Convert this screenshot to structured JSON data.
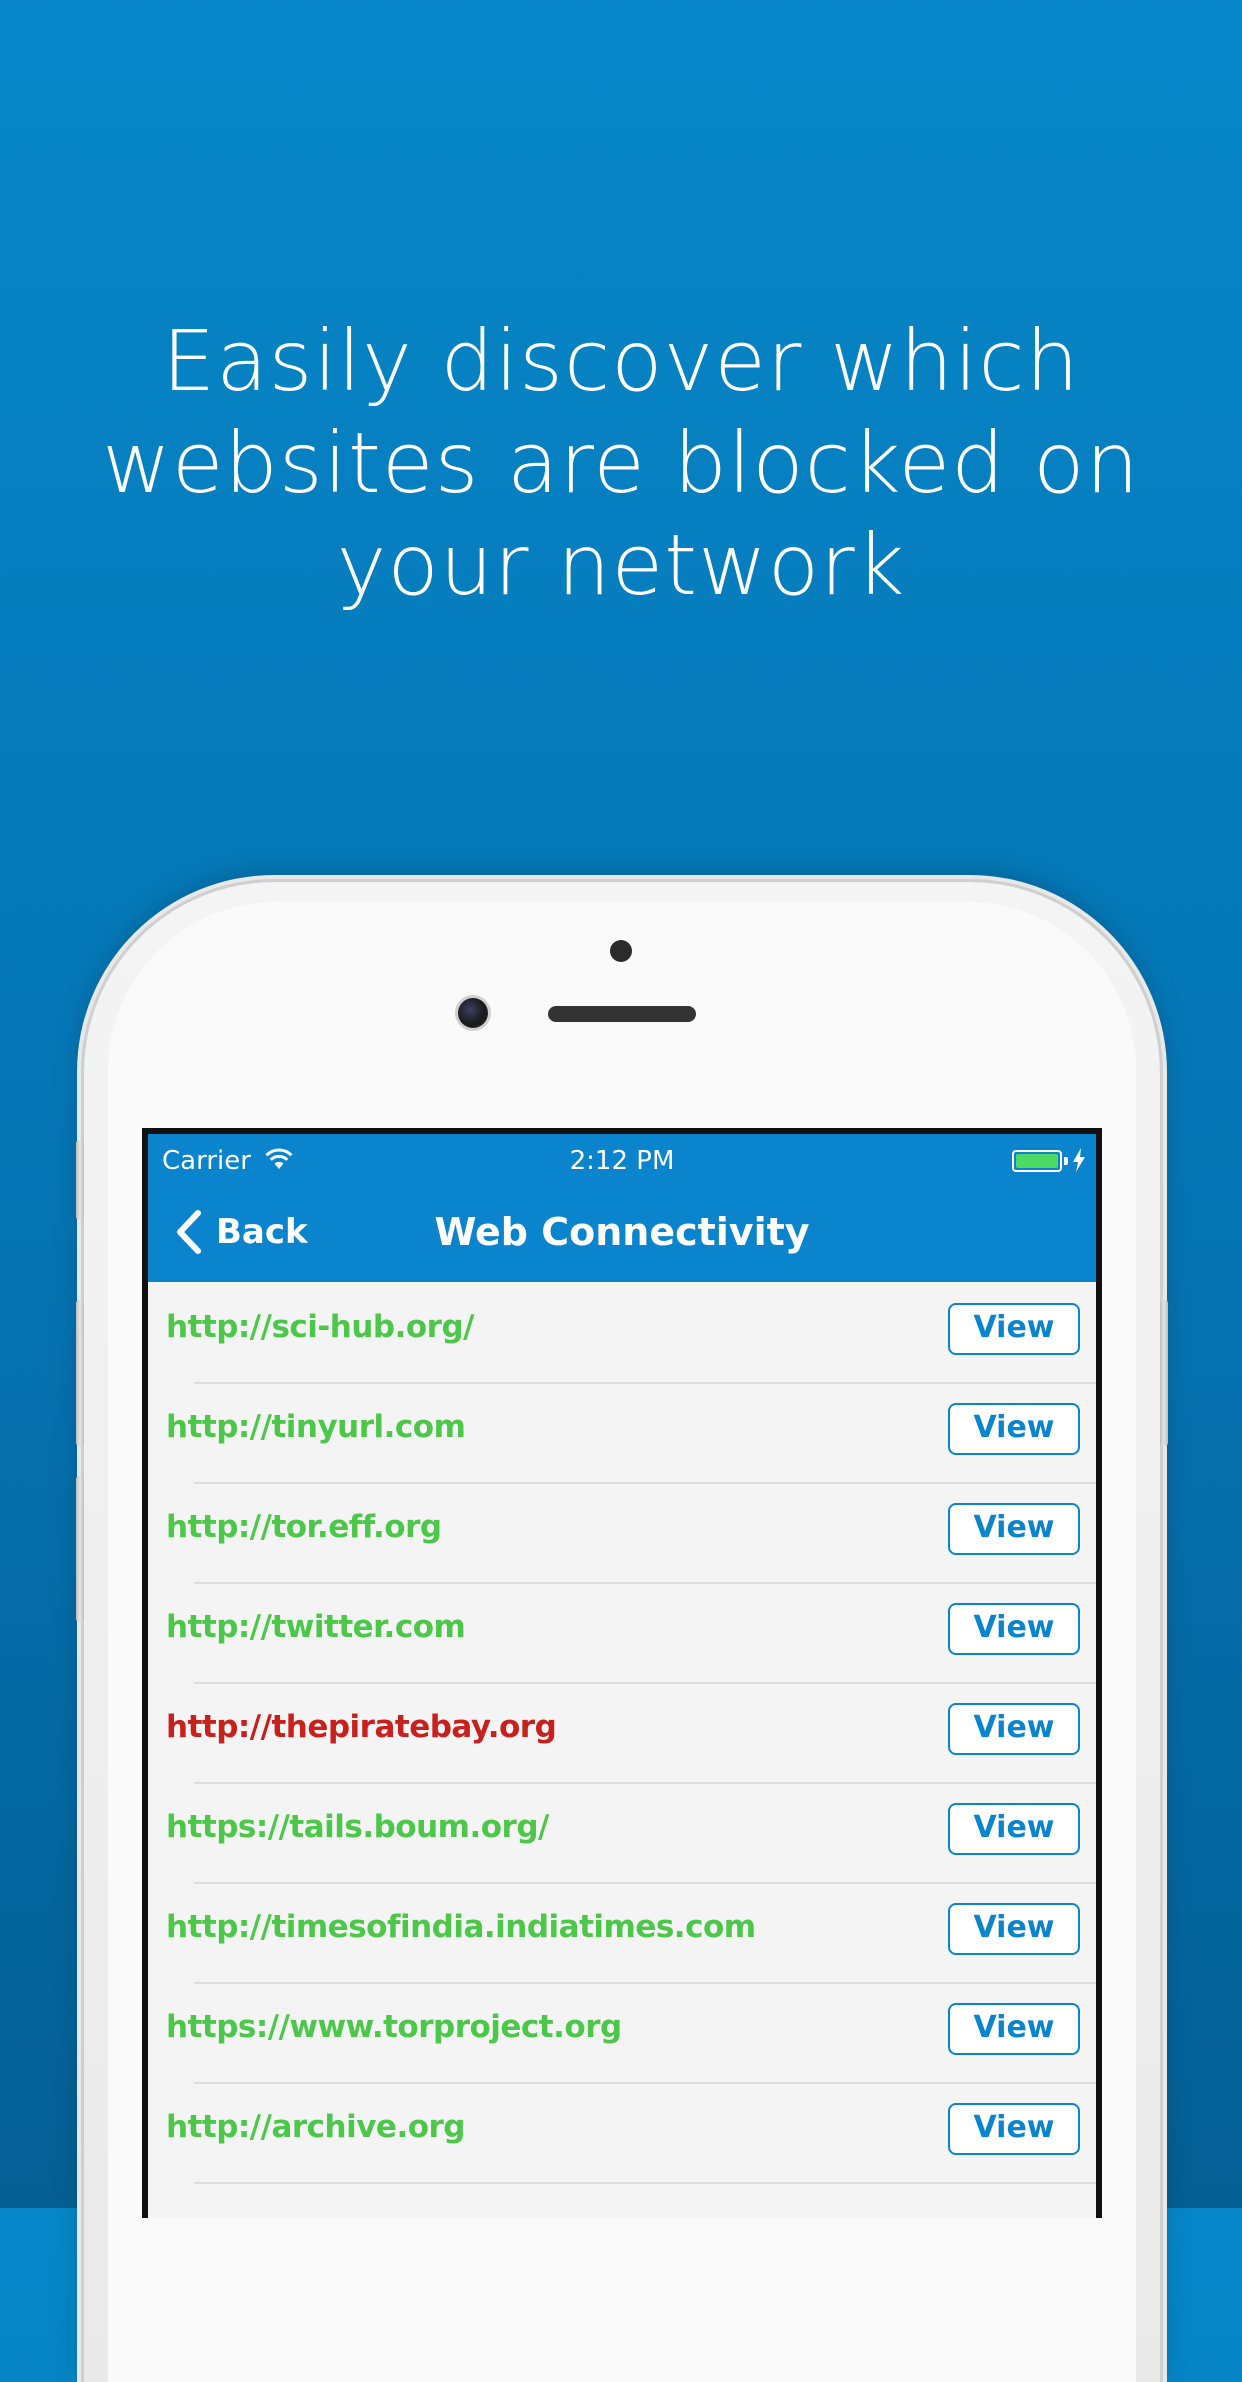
{
  "headline": {
    "line1": "Easily discover which",
    "line2": "websites are blocked on",
    "line3": "your network"
  },
  "status_bar": {
    "carrier": "Carrier",
    "time": "2:12 PM",
    "battery_level": 1.0,
    "charging": true
  },
  "nav": {
    "back_label": "Back",
    "title": "Web Connectivity"
  },
  "colors": {
    "accent": "#0a84cc",
    "accessible": "#4cc749",
    "blocked": "#c8201c",
    "background": "#0687c9"
  },
  "sites": [
    {
      "url": "http://sci-hub.org/",
      "status": "accessible",
      "action": "View"
    },
    {
      "url": "http://tinyurl.com",
      "status": "accessible",
      "action": "View"
    },
    {
      "url": "http://tor.eff.org",
      "status": "accessible",
      "action": "View"
    },
    {
      "url": "http://twitter.com",
      "status": "accessible",
      "action": "View"
    },
    {
      "url": "http://thepiratebay.org",
      "status": "blocked",
      "action": "View"
    },
    {
      "url": "https://tails.boum.org/",
      "status": "accessible",
      "action": "View"
    },
    {
      "url": "http://timesofindia.indiatimes.com",
      "status": "accessible",
      "action": "View"
    },
    {
      "url": "https://www.torproject.org",
      "status": "accessible",
      "action": "View"
    },
    {
      "url": "http://archive.org",
      "status": "accessible",
      "action": "View"
    }
  ]
}
